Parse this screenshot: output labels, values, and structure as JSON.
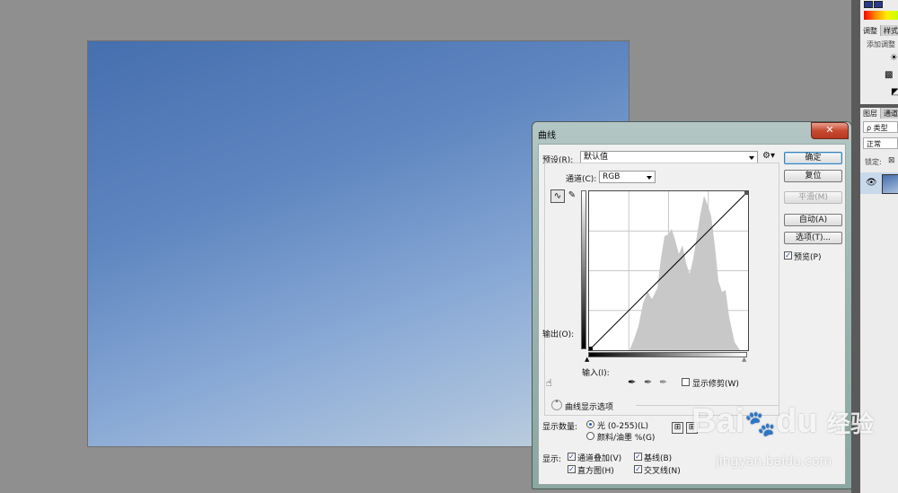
{
  "right_panels": {
    "adjustments_tab": "调整",
    "styles_tab": "样式",
    "add_adjustment": "添加调整",
    "layers_tab": "图层",
    "channels_tab": "通道",
    "kind_label": "ρ 类型",
    "blend_mode": "正常",
    "lock_label": "锁定:"
  },
  "dialog": {
    "title": "曲线",
    "close_glyph": "✕",
    "preset_label": "预设(R):",
    "preset_value": "默认值",
    "channel_label": "通道(C):",
    "channel_value": "RGB",
    "output_label": "输出(O):",
    "input_label": "输入(I):",
    "show_clipping_label": "显示修剪(W)",
    "curve_display_options": "曲线显示选项",
    "show_amount_label": "显示数量:",
    "light_label": "光 (0-255)(L)",
    "pigment_label": "颜料/油墨 %(G)",
    "show_label": "显示:",
    "channel_overlay_label": "通道叠加(V)",
    "baseline_label": "基线(B)",
    "histogram_label": "直方图(H)",
    "intersection_label": "交叉线(N)",
    "buttons": {
      "ok": "确定",
      "reset": "复位",
      "smooth": "平滑(M)",
      "auto": "自动(A)",
      "options": "选项(T)..."
    },
    "preview_label": "预览(P)",
    "preview_checked": true,
    "show_clipping_checked": false,
    "channel_overlay_checked": true,
    "baseline_checked": true,
    "histogram_checked": true,
    "intersection_checked": true,
    "light_selected": true
  },
  "watermark": {
    "brand": "Bai",
    "paw": "🐾",
    "brand2": "du",
    "suffix": "经验",
    "url": "jingyan.baidu.com"
  }
}
